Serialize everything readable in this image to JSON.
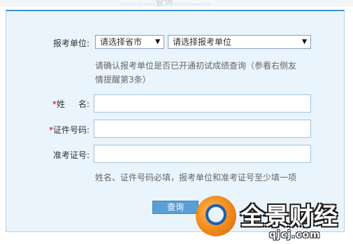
{
  "header": {
    "faded_text": "…………查询…………"
  },
  "form": {
    "unit_label": "报考单位:",
    "province_select": "请选择省市",
    "unit_select": "请选择报考单位",
    "unit_hint": "请确认报考单位是否已开通初试成绩查询（参看右侧友情提醒第3条）",
    "unit_hint_line1": "请确认报考单位是否已开通初试成绩查询（参看右侧友",
    "unit_hint_line2": "情提醒第3条）",
    "name_label_star": "*",
    "name_label": "姓     名:",
    "name_value": "",
    "id_label_star": "*",
    "id_label": "证件号码:",
    "id_value": "",
    "exam_id_label": "准考证号:",
    "exam_id_value": "",
    "bottom_hint": "姓名、证件号码必填，报考单位和准考证号至少填一项",
    "query_button": "查询"
  },
  "watermark": {
    "brand": "全景财经",
    "site": "qjcj.com"
  },
  "colors": {
    "panel_bg": "#eaf4fc",
    "panel_top_border": "#3f8fd0",
    "button_bg": "#5a9fd6",
    "required": "#d40000"
  }
}
